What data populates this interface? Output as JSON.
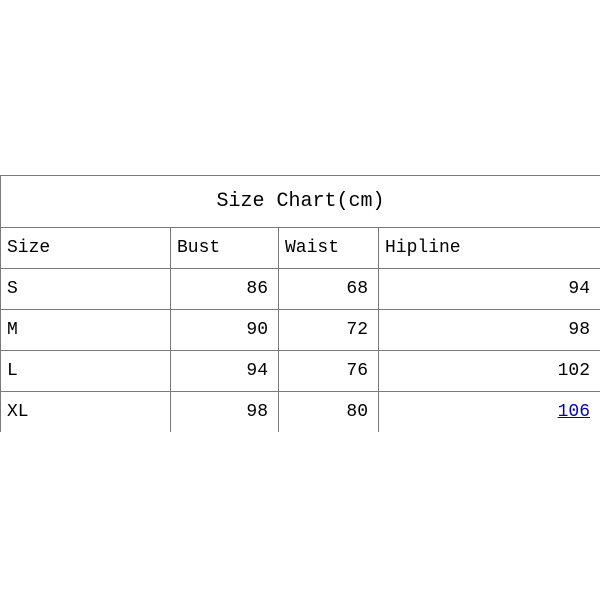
{
  "chart_data": {
    "type": "table",
    "title": "Size Chart(cm)",
    "columns": [
      "Size",
      "Bust",
      "Waist",
      "Hipline"
    ],
    "rows": [
      {
        "Size": "S",
        "Bust": 86,
        "Waist": 68,
        "Hipline": 94
      },
      {
        "Size": "M",
        "Bust": 90,
        "Waist": 72,
        "Hipline": 98
      },
      {
        "Size": "L",
        "Bust": 94,
        "Waist": 76,
        "Hipline": 102
      },
      {
        "Size": "XL",
        "Bust": 98,
        "Waist": 80,
        "Hipline": 106
      }
    ],
    "linked_cell": {
      "row": 3,
      "column": "Hipline"
    }
  }
}
